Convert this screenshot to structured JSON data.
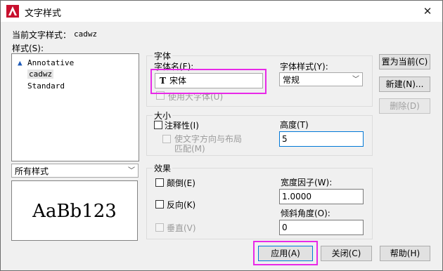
{
  "title": "文字样式",
  "current_style": {
    "label": "当前文字样式：",
    "value": "cadwz"
  },
  "styles_label": "样式(S):",
  "styles": [
    {
      "name": "Annotative",
      "annotative": true,
      "selected": false
    },
    {
      "name": "cadwz",
      "annotative": false,
      "selected": true
    },
    {
      "name": "Standard",
      "annotative": false,
      "selected": false
    }
  ],
  "filter": {
    "value": "所有样式"
  },
  "preview_text": "AaBb123",
  "font": {
    "group_label": "字体",
    "name_label": "字体名(F):",
    "name_value": "宋体",
    "style_label": "字体样式(Y):",
    "style_value": "常规",
    "big_font_label": "使用大字体(U)"
  },
  "size": {
    "group_label": "大小",
    "annotative_label": "注释性(I)",
    "match_orientation_line1": "使文字方向与布局",
    "match_orientation_line2": "匹配(M)",
    "height_label": "高度(T)",
    "height_value": "5"
  },
  "effects": {
    "group_label": "效果",
    "upside_down_label": "颠倒(E)",
    "backwards_label": "反向(K)",
    "vertical_label": "垂直(V)",
    "width_factor_label": "宽度因子(W):",
    "width_factor_value": "1.0000",
    "oblique_label": "倾斜角度(O):",
    "oblique_value": "0"
  },
  "buttons": {
    "set_current": "置为当前(C)",
    "new": "新建(N)...",
    "delete": "删除(D)",
    "apply": "应用(A)",
    "close": "关闭(C)",
    "help": "帮助(H)"
  },
  "colors": {
    "highlight": "#e829e8",
    "accent": "#0078d7",
    "app_icon": "#c8102e"
  }
}
